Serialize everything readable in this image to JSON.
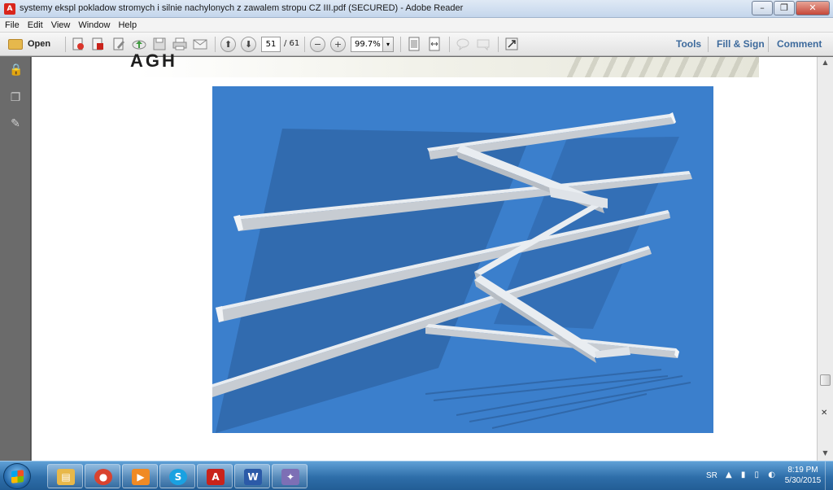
{
  "window": {
    "title": "systemy ekspl pokladow stromych i silnie nachylonych z zawalem stropu CZ III.pdf (SECURED) - Adobe Reader",
    "app_icon_glyph": "A",
    "minimize_glyph": "–",
    "maximize_glyph": "❐",
    "close_glyph": "✕"
  },
  "menu": {
    "items": [
      "File",
      "Edit",
      "View",
      "Window",
      "Help"
    ]
  },
  "toolbar": {
    "open_label": "Open",
    "page_current": "51",
    "page_total": "/ 61",
    "zoom_value": "99.7%",
    "zoom_arrow": "▾",
    "prev_glyph": "⬆",
    "next_glyph": "⬇",
    "zoom_out_glyph": "−",
    "zoom_in_glyph": "+",
    "tools_label": "Tools",
    "fill_sign_label": "Fill & Sign",
    "comment_label": "Comment",
    "icons": [
      "create-pdf-icon",
      "share-icon",
      "edit-icon",
      "upload-icon",
      "save-icon",
      "print-icon",
      "email-icon",
      "fit-page-icon",
      "fit-width-icon",
      "comment-bubble-icon",
      "highlight-icon",
      "fullscreen-icon"
    ]
  },
  "leftpane": {
    "lock_glyph": "🔒",
    "pages_glyph": "❐",
    "attach_glyph": "✎"
  },
  "document": {
    "header_text": "AGH"
  },
  "scrollbar": {
    "up_glyph": "▲",
    "down_glyph": "▼",
    "close_glyph": "✕"
  },
  "taskbar": {
    "apps": [
      {
        "name": "explorer",
        "glyph": "▤",
        "color": "#e8b84a"
      },
      {
        "name": "chrome",
        "glyph": "●",
        "color": "#d9432f"
      },
      {
        "name": "media-player",
        "glyph": "▶",
        "color": "#f08a24"
      },
      {
        "name": "skype",
        "glyph": "S",
        "color": "#1aa1e1"
      },
      {
        "name": "adobe-reader",
        "glyph": "A",
        "color": "#c9231b"
      },
      {
        "name": "word",
        "glyph": "W",
        "color": "#2b5aa8"
      },
      {
        "name": "app-7",
        "glyph": "✦",
        "color": "#7d6fb5"
      }
    ],
    "language": "SR",
    "tray_glyphs": "▲ ▮ ▯ ◐",
    "time": "8:19 PM",
    "date": "5/30/2015"
  },
  "colors": {
    "figure_background": "#3b7fcc",
    "beam_light": "#e9edf1",
    "beam_mid": "#c7ccd2",
    "beam_dark": "#8c9299",
    "toolbar_link": "#3d6a9c"
  }
}
